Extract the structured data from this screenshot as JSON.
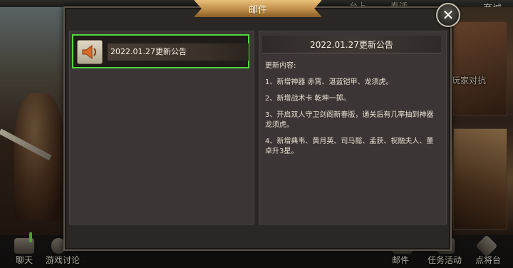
{
  "top_nav": {
    "item_1": "台上",
    "item_2": "寿活",
    "shop": "商城"
  },
  "background": {
    "right_label": "玩家对抗"
  },
  "modal": {
    "title": "邮件",
    "close_symbol": "✕",
    "mail_list": [
      {
        "title": "2022.01.27更新公告",
        "icon": "speaker-icon",
        "selected": true
      }
    ],
    "notice": {
      "title": "2022.01.27更新公告",
      "lines": [
        "更新内容:",
        "1、新增神器 赤霄、湛蓝铠甲、龙须虎。",
        "2、新增战术卡 乾坤一掷。",
        "3、开启双人守卫剑阁新春版，通关后有几率抽到神器龙须虎。",
        "4、新增典韦、黄月英、司马懿、孟获、祝融夫人、董卓升3星。"
      ]
    }
  },
  "bottom_bar": {
    "chat": "聊天",
    "forum": "游戏讨论",
    "mail": "邮件",
    "tasks": "任务活动",
    "generals": "点将台"
  },
  "colors": {
    "selected_border": "#4ed83a",
    "ribbon": "#c08e48",
    "panel": "#3b3535"
  }
}
